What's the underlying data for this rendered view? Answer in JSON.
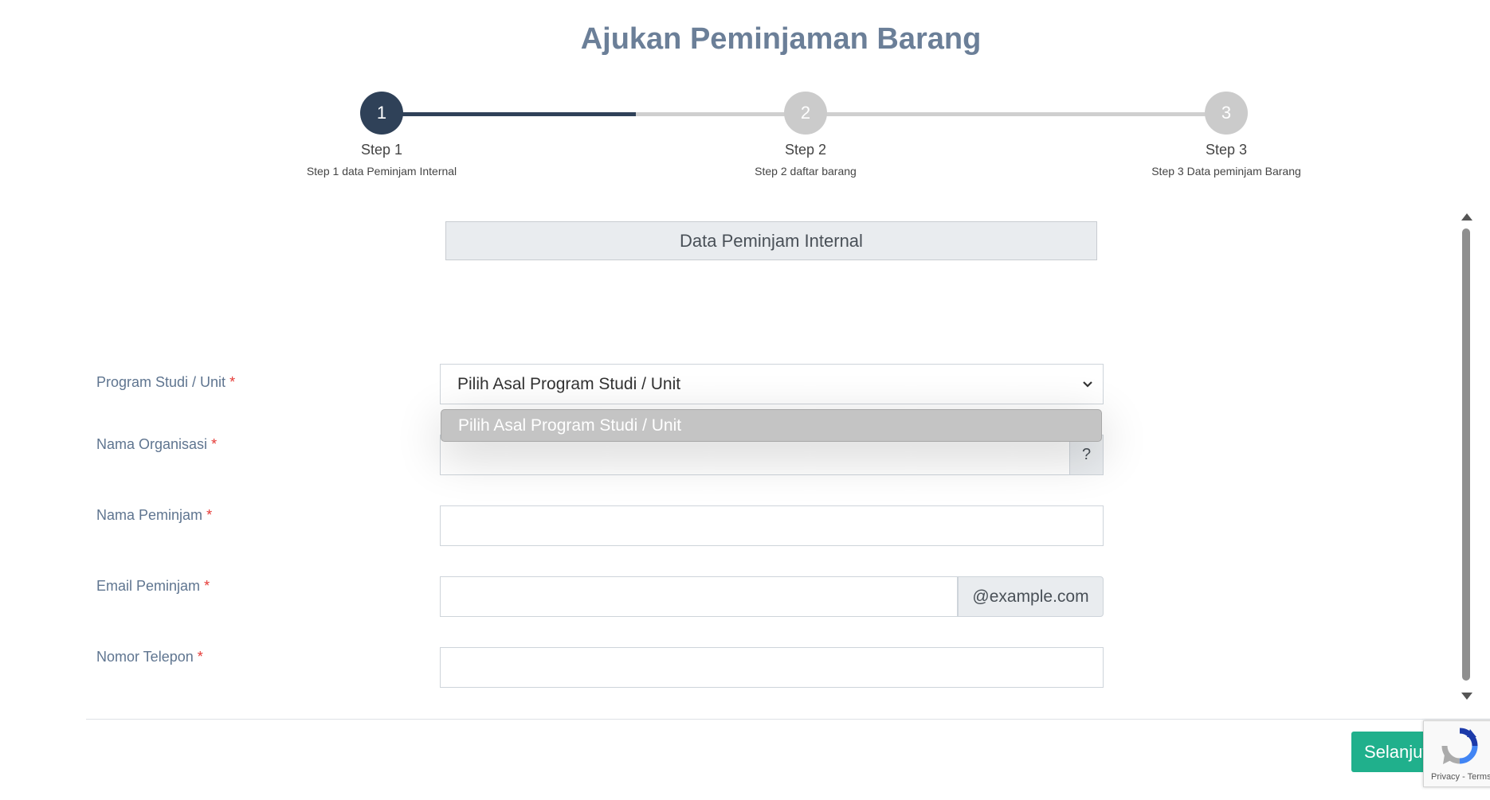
{
  "page": {
    "title": "Ajukan Peminjaman Barang"
  },
  "steps": [
    {
      "number": "1",
      "label": "Step 1",
      "description": "Step 1 data Peminjam Internal",
      "active": true
    },
    {
      "number": "2",
      "label": "Step 2",
      "description": "Step 2 daftar barang",
      "active": false
    },
    {
      "number": "3",
      "label": "Step 3",
      "description": "Step 3 Data peminjam Barang",
      "active": false
    }
  ],
  "section": {
    "title": "Data Peminjam Internal"
  },
  "form": {
    "required_marker": "*",
    "program_studi": {
      "label": "Program Studi / Unit",
      "selected": "Pilih Asal Program Studi / Unit",
      "options": [
        "Pilih Asal Program Studi / Unit"
      ]
    },
    "nama_organisasi": {
      "label": "Nama Organisasi",
      "value": "",
      "help_addon": "?"
    },
    "nama_peminjam": {
      "label": "Nama Peminjam",
      "value": ""
    },
    "email_peminjam": {
      "label": "Email Peminjam",
      "value": "",
      "domain_addon": "@example.com"
    },
    "nomor_telepon": {
      "label": "Nomor Telepon",
      "value": ""
    }
  },
  "footer": {
    "next_button": "Selanjut"
  },
  "recaptcha": {
    "links": "Privacy - Terms"
  },
  "colors": {
    "accent": "#2f4158",
    "button": "#20b08c",
    "title": "#6b7f98",
    "required": "#e53935"
  }
}
